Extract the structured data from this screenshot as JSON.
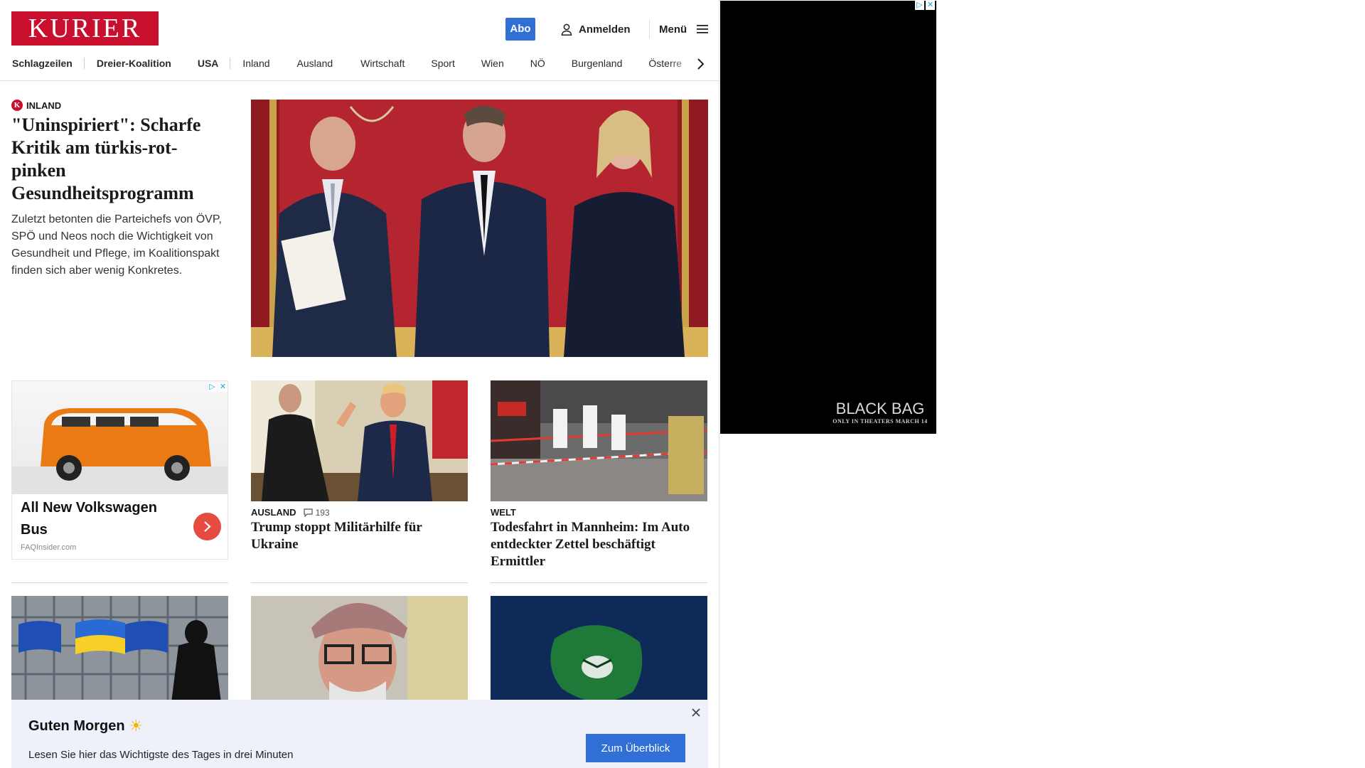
{
  "header": {
    "logo": "KURIER",
    "abo_label": "Abo",
    "login_label": "Anmelden",
    "menu_label": "Menü"
  },
  "nav": {
    "items": [
      "Schlagzeilen",
      "Dreier-Koalition",
      "USA",
      "Inland",
      "Ausland",
      "Wirtschaft",
      "Sport",
      "Wien",
      "NÖ",
      "Burgenland",
      "Österre"
    ]
  },
  "hero": {
    "badge": "K",
    "kicker": "INLAND",
    "title": "\"Uninspiriert\": Scharfe Kritik am türkis-rot-pinken Gesundheitsprogramm",
    "lead": "Zuletzt betonten die Parteichefs von ÖVP, SPÖ und Neos noch die Wichtigkeit von Gesundheit und Pflege, im Koalitionspakt finden sich aber wenig Konkretes."
  },
  "ad_card": {
    "title": "All New Volkswagen Bus",
    "source": "FAQInsider.com"
  },
  "teasers": [
    {
      "kicker": "AUSLAND",
      "comments": "193",
      "title": "Trump stoppt Militärhilfe für Ukraine"
    },
    {
      "kicker": "WELT",
      "title": "Todesfahrt in Mannheim: Im Auto entdeckter Zettel beschäftigt Ermittler"
    }
  ],
  "side_ad": {
    "brand": "BLACK BAG",
    "tagline": "ONLY IN THEATERS MARCH 14"
  },
  "banner": {
    "title": "Guten Morgen",
    "text": "Lesen Sie hier das Wichtigste des Tages in drei Minuten",
    "button_label": "Zum Überblick"
  },
  "colors": {
    "brand_red": "#c8102e",
    "accent_blue": "#2f6fd6",
    "banner_bg": "#eef1fa"
  }
}
